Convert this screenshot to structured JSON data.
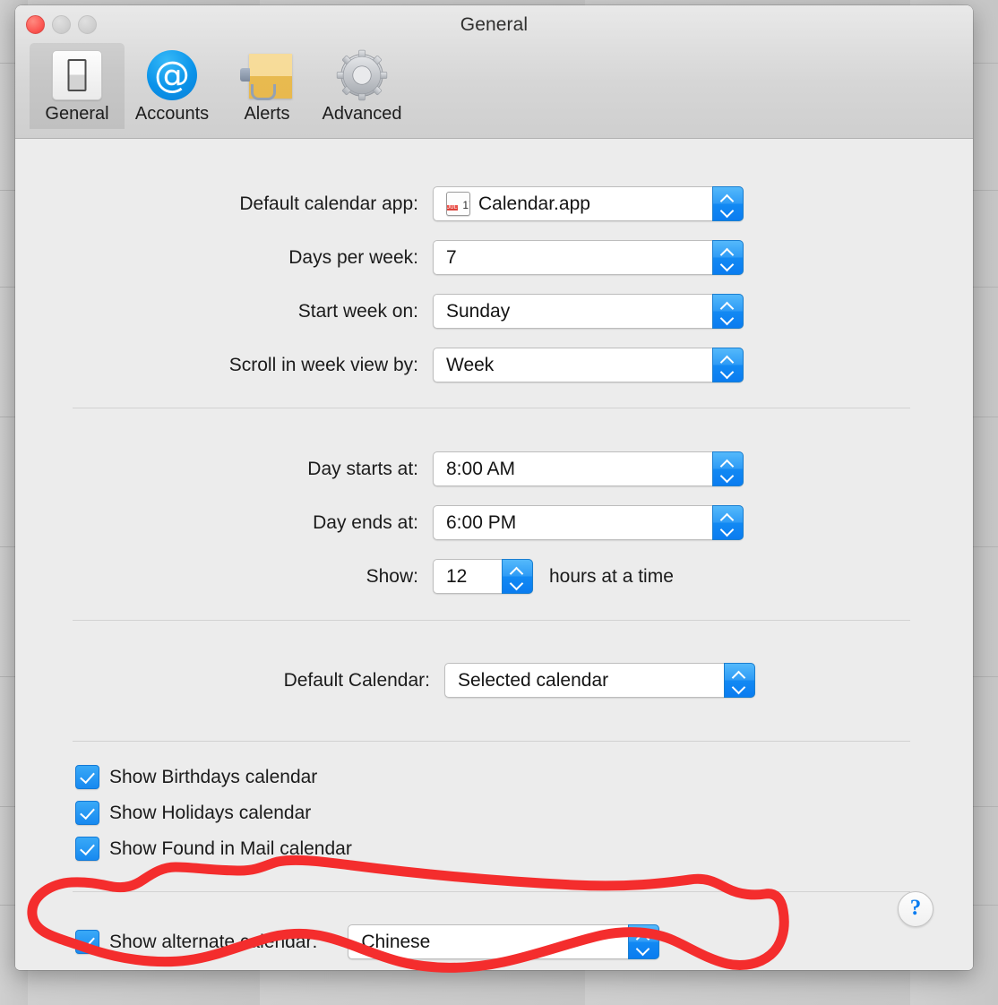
{
  "window": {
    "title": "General",
    "traffic_lights": [
      "close",
      "minimize",
      "maximize"
    ]
  },
  "toolbar": {
    "tabs": [
      {
        "label": "General",
        "icon": "switch-icon",
        "selected": true
      },
      {
        "label": "Accounts",
        "icon": "at-sign-icon",
        "selected": false
      },
      {
        "label": "Alerts",
        "icon": "megaphone-icon",
        "selected": false
      },
      {
        "label": "Advanced",
        "icon": "gear-icon",
        "selected": false
      }
    ]
  },
  "sections": {
    "section1": {
      "rows": [
        {
          "label": "Default calendar app:",
          "value": "Calendar.app",
          "has_app_icon": true,
          "icon_month": "JUL",
          "icon_day": "17"
        },
        {
          "label": "Days per week:",
          "value": "7",
          "has_app_icon": false
        },
        {
          "label": "Start week on:",
          "value": "Sunday",
          "has_app_icon": false
        },
        {
          "label": "Scroll in week view by:",
          "value": "Week",
          "has_app_icon": false
        }
      ]
    },
    "section2": {
      "rows": [
        {
          "label": "Day starts at:",
          "value": "8:00 AM"
        },
        {
          "label": "Day ends at:",
          "value": "6:00 PM"
        }
      ],
      "show_row": {
        "label": "Show:",
        "value": "12",
        "suffix": "hours at a time"
      }
    },
    "section3": {
      "row": {
        "label": "Default Calendar:",
        "value": "Selected calendar"
      }
    },
    "section4": {
      "checkboxes": [
        {
          "label": "Show Birthdays calendar",
          "checked": true
        },
        {
          "label": "Show Holidays calendar",
          "checked": true
        },
        {
          "label": "Show Found in Mail calendar",
          "checked": true
        }
      ]
    },
    "section5": {
      "checkbox": {
        "label": "Show alternate calendar:",
        "checked": true
      },
      "value": "Chinese"
    }
  },
  "help_button": {
    "glyph": "?"
  },
  "annotation": {
    "type": "hand-drawn-red-circle",
    "color": "#f42d2d",
    "target": "Show alternate calendar: Chinese"
  },
  "colors": {
    "accent_blue": "#0a7cf0",
    "checkbox_blue": "#1789f0",
    "window_bg": "#ececec",
    "chrome_bg": "#d6d6d6",
    "annotation_red": "#f42d2d"
  }
}
